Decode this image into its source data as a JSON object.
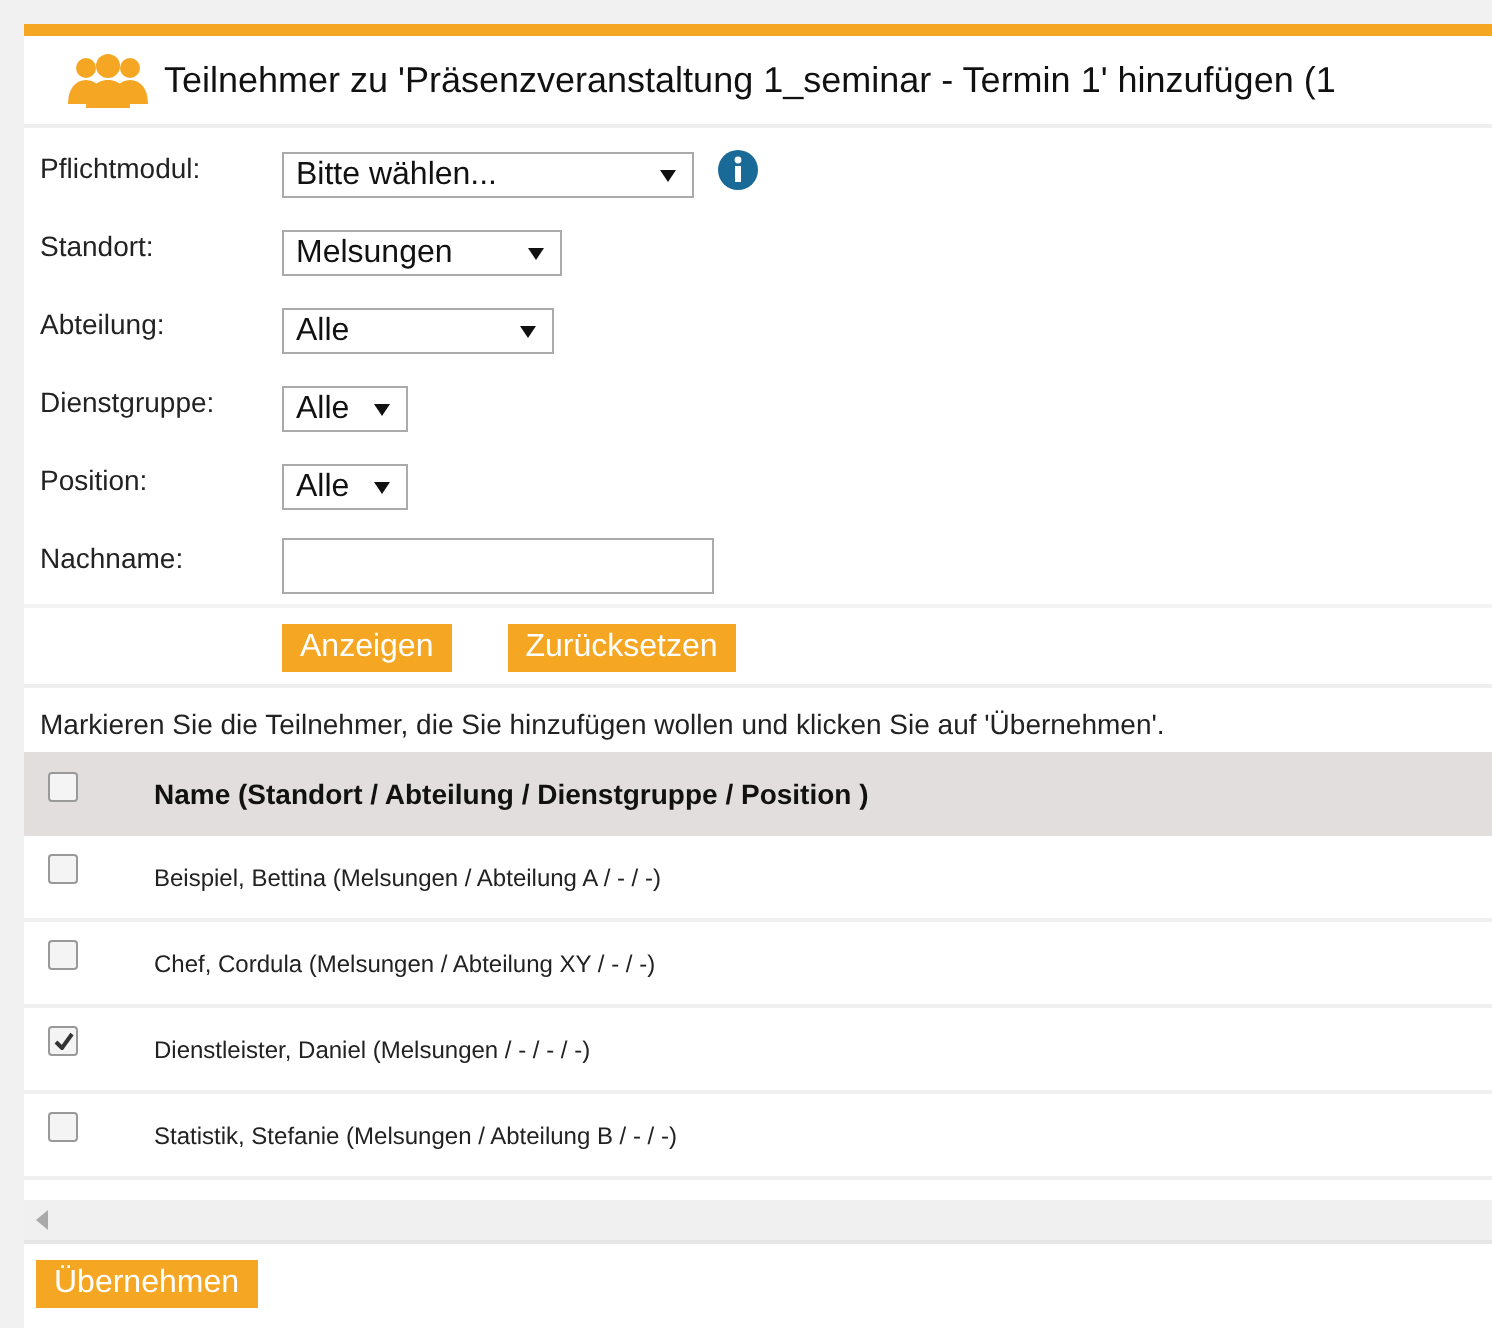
{
  "title": "Teilnehmer zu 'Präsenzveranstaltung 1_seminar - Termin 1' hinzufügen (1",
  "filters": [
    {
      "label": "Pflichtmodul:",
      "kind": "select",
      "value": "Bitte wählen...",
      "info": true
    },
    {
      "label": "Standort:",
      "kind": "select",
      "value": "Melsungen",
      "info": false
    },
    {
      "label": "Abteilung:",
      "kind": "select",
      "value": "Alle",
      "info": false
    },
    {
      "label": "Dienstgruppe:",
      "kind": "select",
      "value": "Alle",
      "info": false
    },
    {
      "label": "Position:",
      "kind": "select",
      "value": "Alle",
      "info": false
    },
    {
      "label": "Nachname:",
      "kind": "text",
      "info": false
    }
  ],
  "actions": [
    "Anzeigen",
    "Zurücksetzen"
  ],
  "instruction": "Markieren Sie die Teilnehmer, die Sie hinzufügen wollen und klicken Sie auf 'Übernehmen'.",
  "table": {
    "header": {
      "label": "Name (Standort / Abteilung / Dienstgruppe / Position )",
      "checked": false
    },
    "rows": [
      {
        "name": "Beispiel, Bettina (Melsungen / Abteilung A / - / -)",
        "checked": false
      },
      {
        "name": "Chef, Cordula (Melsungen / Abteilung XY / - / -)",
        "checked": false
      },
      {
        "name": "Dienstleister, Daniel (Melsungen / - / - / -)",
        "checked": true
      },
      {
        "name": "Statistik, Stefanie (Melsungen / Abteilung B / - / -)",
        "checked": false
      }
    ]
  },
  "submit": "Übernehmen"
}
